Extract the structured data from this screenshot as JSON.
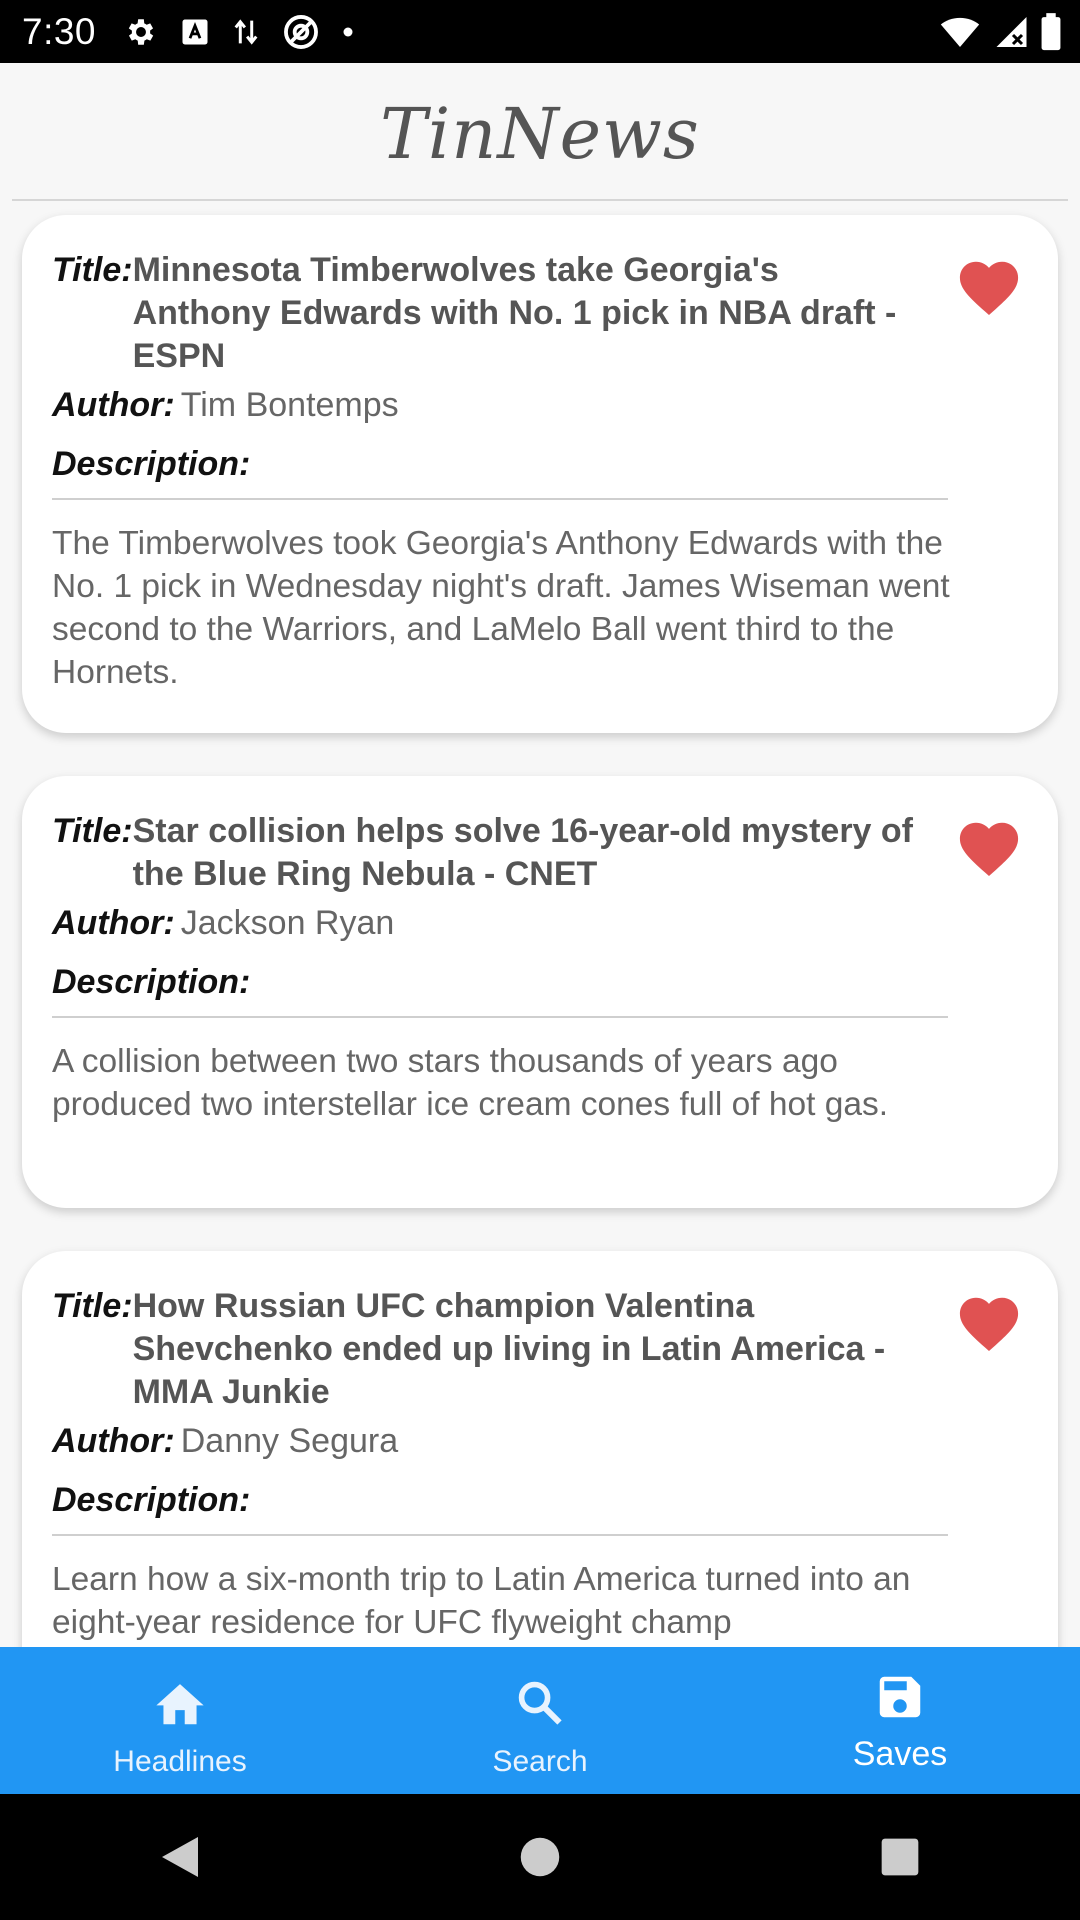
{
  "status_bar": {
    "time": "7:30",
    "icons_left": [
      "gear-icon",
      "text-a-icon",
      "data-arrows-icon",
      "at-icon",
      "dot-icon"
    ],
    "icons_right": [
      "wifi-icon",
      "signal-icon",
      "battery-icon"
    ]
  },
  "app_bar": {
    "title": "TinNews"
  },
  "labels": {
    "title": "Title:",
    "author": "Author:",
    "description": "Description:"
  },
  "articles": [
    {
      "title": "Minnesota Timberwolves take Georgia's Anthony Edwards with No. 1 pick in NBA draft - ESPN",
      "author": "Tim Bontemps",
      "description": "The Timberwolves took Georgia's Anthony Edwards with the No. 1 pick in Wednesday night's draft. James Wiseman went second to the Warriors, and LaMelo Ball went third to the Hornets.",
      "saved": true
    },
    {
      "title": "Star collision helps solve 16-year-old mystery of the Blue Ring Nebula - CNET",
      "author": "Jackson Ryan",
      "description": "A collision between two stars thousands of years ago produced two interstellar ice cream cones full of hot gas.",
      "saved": true
    },
    {
      "title": "How Russian UFC champion Valentina Shevchenko ended up living in Latin America - MMA Junkie",
      "author": "Danny Segura",
      "description": "Learn how a six-month trip to Latin America turned into an eight-year residence for UFC flyweight champ",
      "saved": true
    }
  ],
  "bottom_nav": {
    "items": [
      {
        "label": "Headlines",
        "icon": "home-icon"
      },
      {
        "label": "Search",
        "icon": "search-icon"
      },
      {
        "label": "Saves",
        "icon": "save-icon",
        "active": true
      }
    ]
  },
  "colors": {
    "accent": "#2196f3",
    "heart": "#e05252",
    "background": "#f7f7f7"
  }
}
